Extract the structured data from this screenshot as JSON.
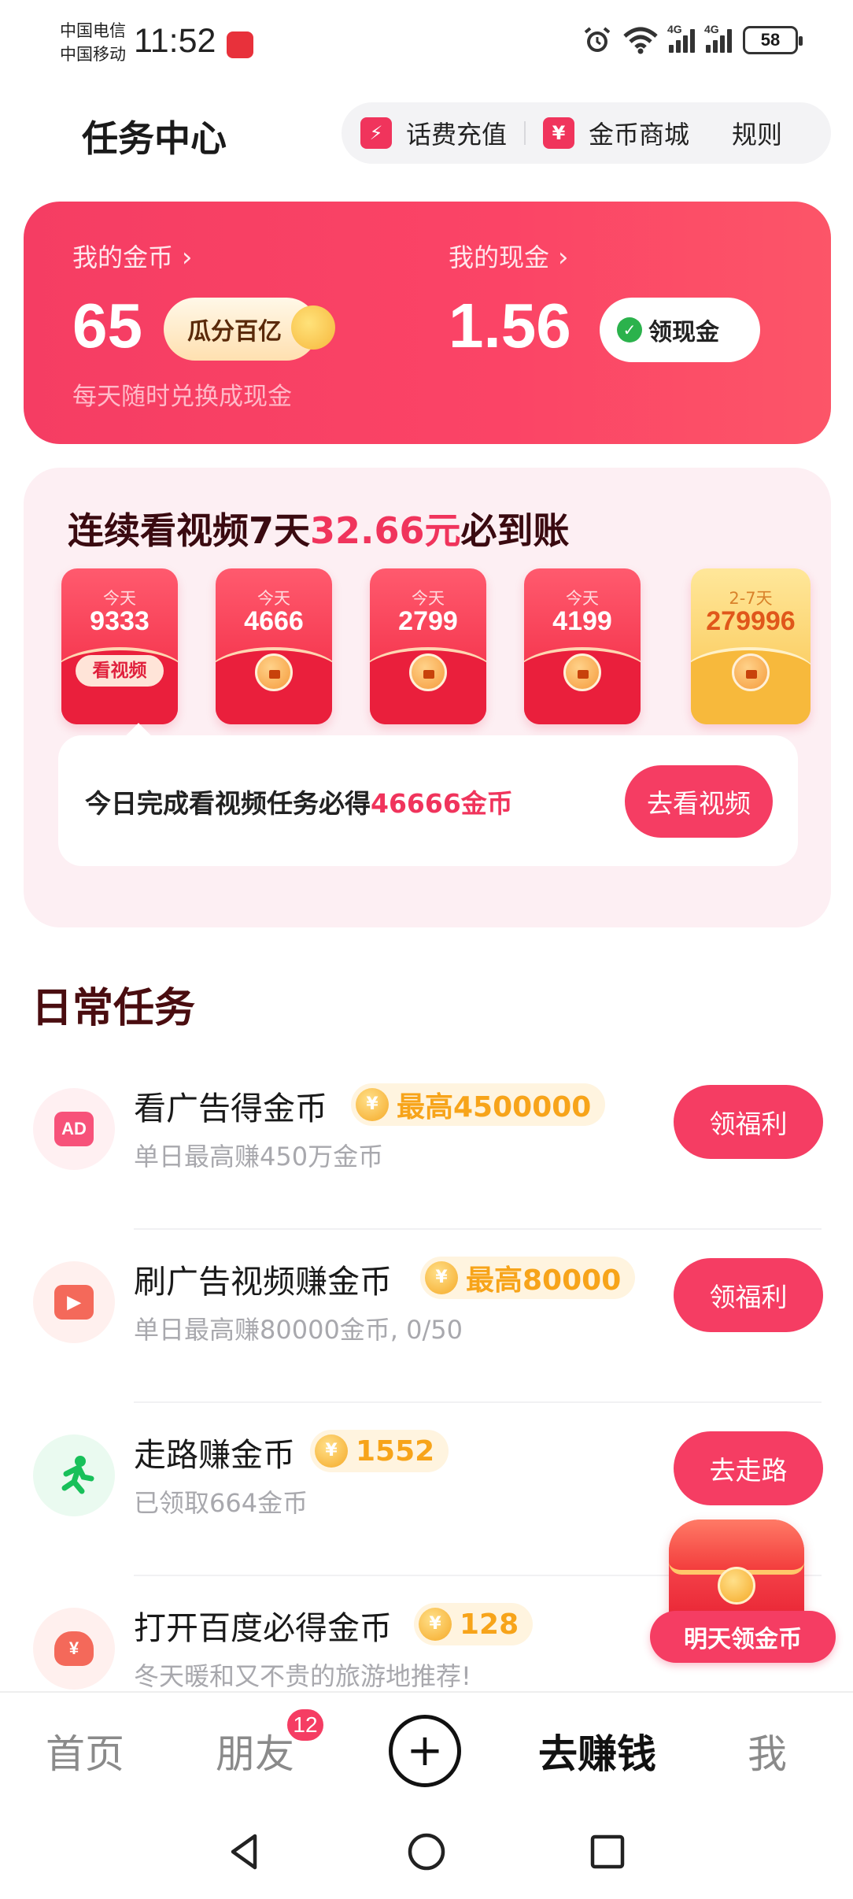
{
  "status_bar": {
    "carrier1": "中国电信",
    "carrier2": "中国移动",
    "time": "11:52",
    "signal1": "4G",
    "signal2": "4G",
    "battery": "58",
    "icons": [
      "alarm-icon",
      "wifi-icon",
      "signal-icon",
      "battery-icon"
    ]
  },
  "header": {
    "title": "任务中心",
    "recharge": "话费充值",
    "mall": "金币商城",
    "rules": "规则"
  },
  "wallet": {
    "coins_label": "我的金币",
    "coins_value": "65",
    "promo": "瓜分百亿",
    "cash_label": "我的现金",
    "cash_value": "1.56",
    "cash_button": "领现金",
    "sub": "每天随时兑换成现金"
  },
  "streak": {
    "title_pre": "连续看视频7天",
    "title_amount": "32.66元",
    "title_post": "必到账",
    "envelopes": [
      {
        "day": "今天",
        "amount": "9333",
        "action": "看视频"
      },
      {
        "day": "今天",
        "amount": "4666"
      },
      {
        "day": "今天",
        "amount": "2799"
      },
      {
        "day": "今天",
        "amount": "4199"
      },
      {
        "day": "2-7天",
        "amount": "279996"
      }
    ],
    "task_text": "今日完成看视频任务必得",
    "task_reward": "46666金币",
    "task_button": "去看视频"
  },
  "daily": {
    "title": "日常任务",
    "tasks": [
      {
        "name": "看广告得金币",
        "reward": "最高4500000",
        "sub": "单日最高赚450万金币",
        "button": "领福利",
        "icon": "ad-icon"
      },
      {
        "name": "刷广告视频赚金币",
        "reward": "最高80000",
        "sub": "单日最高赚80000金币, 0/50",
        "button": "领福利",
        "icon": "video-icon"
      },
      {
        "name": "走路赚金币",
        "reward": "1552",
        "sub": "已领取664金币",
        "button": "去走路",
        "icon": "walking-icon"
      },
      {
        "name": "打开百度必得金币",
        "reward": "128",
        "sub": "冬天暖和又不贵的旅游地推荐!",
        "button": "",
        "icon": "money-bag-icon"
      }
    ]
  },
  "floating": {
    "label": "明天领金币"
  },
  "bottom_nav": {
    "home": "首页",
    "friends": "朋友",
    "friends_badge": "12",
    "earn": "去赚钱",
    "me": "我"
  },
  "colors": {
    "accent": "#f53d63",
    "coin": "#f7a41a",
    "dark_red": "#4a0d10"
  }
}
